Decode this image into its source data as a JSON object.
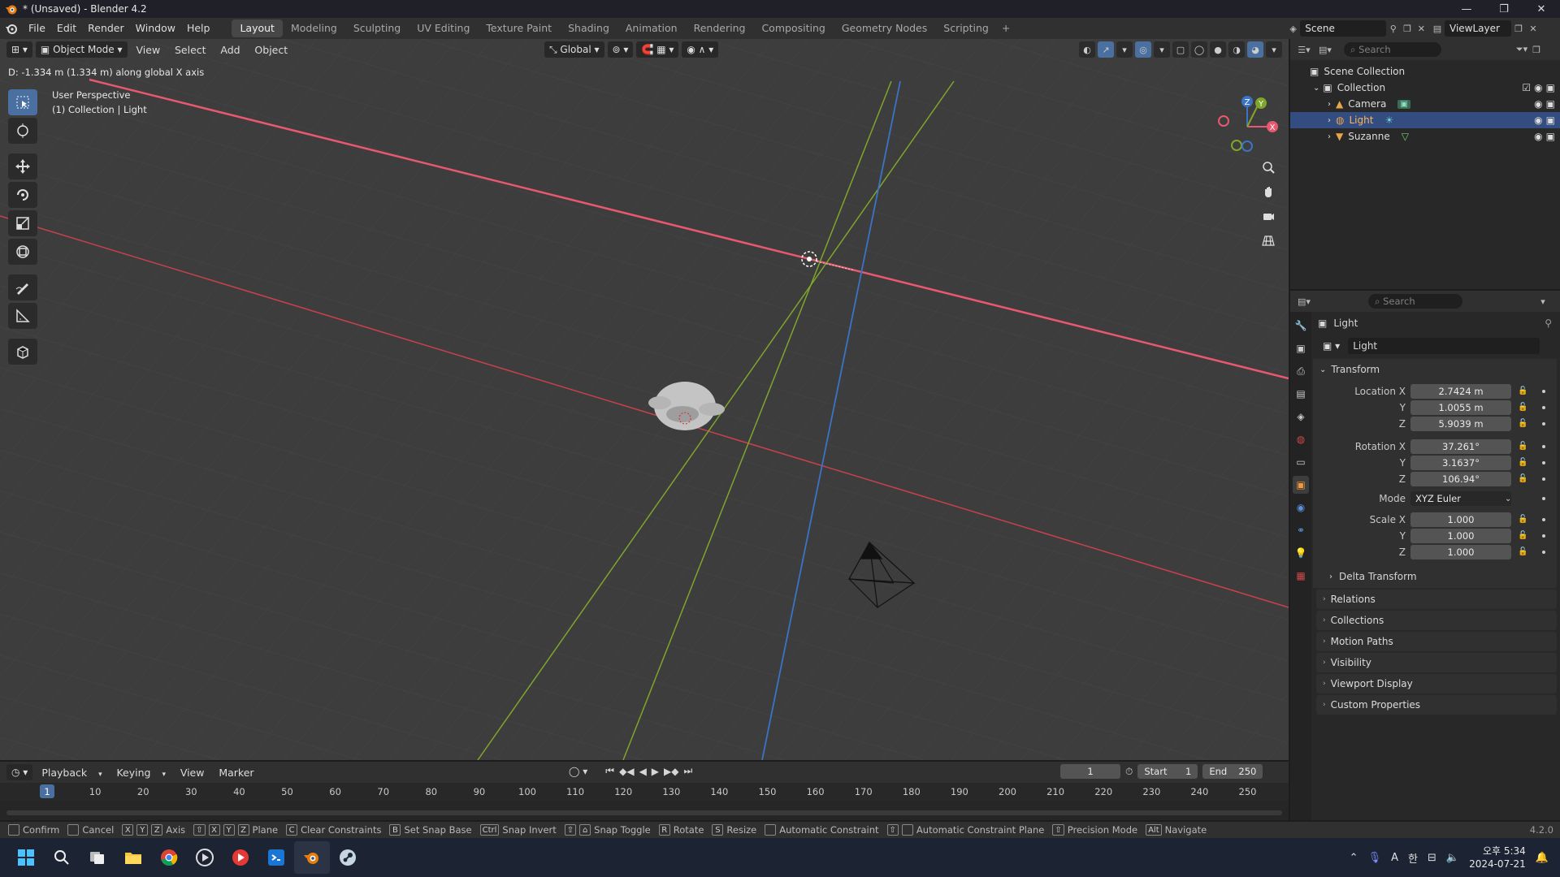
{
  "window": {
    "title": "* (Unsaved) - Blender 4.2"
  },
  "menus": [
    "File",
    "Edit",
    "Render",
    "Window",
    "Help"
  ],
  "workspaces": [
    {
      "label": "Layout",
      "active": true
    },
    {
      "label": "Modeling"
    },
    {
      "label": "Sculpting"
    },
    {
      "label": "UV Editing"
    },
    {
      "label": "Texture Paint"
    },
    {
      "label": "Shading"
    },
    {
      "label": "Animation"
    },
    {
      "label": "Rendering"
    },
    {
      "label": "Compositing"
    },
    {
      "label": "Geometry Nodes"
    },
    {
      "label": "Scripting"
    }
  ],
  "scene": {
    "name": "Scene",
    "view_layer": "ViewLayer"
  },
  "viewport": {
    "mode": "Object Mode",
    "menus": [
      "View",
      "Select",
      "Add",
      "Object"
    ],
    "orientation": "Global",
    "status_text": "D: -1.334 m (1.334 m) along global X axis",
    "perspective": "User Perspective",
    "context": "(1) Collection | Light",
    "gizmo_axes": [
      "X",
      "Y",
      "Z"
    ]
  },
  "outliner": {
    "search_placeholder": "Search",
    "root": "Scene Collection",
    "collection": "Collection",
    "items": [
      {
        "label": "Camera",
        "selected": false
      },
      {
        "label": "Light",
        "selected": true
      },
      {
        "label": "Suzanne",
        "selected": false
      }
    ]
  },
  "properties": {
    "search_placeholder": "Search",
    "object_name": "Light",
    "datablock": "Light",
    "transform_title": "Transform",
    "location": {
      "label_x": "Location X",
      "label_y": "Y",
      "label_z": "Z",
      "x": "2.7424 m",
      "y": "1.0055 m",
      "z": "5.9039 m"
    },
    "rotation": {
      "label_x": "Rotation X",
      "label_y": "Y",
      "label_z": "Z",
      "x": "37.261°",
      "y": "3.1637°",
      "z": "106.94°"
    },
    "mode": {
      "label": "Mode",
      "value": "XYZ Euler"
    },
    "scale": {
      "label_x": "Scale X",
      "label_y": "Y",
      "label_z": "Z",
      "x": "1.000",
      "y": "1.000",
      "z": "1.000"
    },
    "delta_transform": "Delta Transform",
    "panels": [
      "Relations",
      "Collections",
      "Motion Paths",
      "Visibility",
      "Viewport Display",
      "Custom Properties"
    ]
  },
  "timeline": {
    "menus": [
      "Playback",
      "Keying",
      "View",
      "Marker"
    ],
    "current_frame": "1",
    "start_label": "Start",
    "start": "1",
    "end_label": "End",
    "end": "250",
    "ruler": [
      "1",
      "10",
      "20",
      "30",
      "40",
      "50",
      "60",
      "70",
      "80",
      "90",
      "100",
      "110",
      "120",
      "130",
      "140",
      "150",
      "160",
      "170",
      "180",
      "190",
      "200",
      "210",
      "220",
      "230",
      "240",
      "250"
    ]
  },
  "statusbar": {
    "items": [
      {
        "keys": [
          ""
        ],
        "label": "Confirm"
      },
      {
        "keys": [
          ""
        ],
        "label": "Cancel"
      },
      {
        "keys": [
          "X",
          "Y",
          "Z"
        ],
        "label": "Axis"
      },
      {
        "keys": [
          "⇧",
          "X",
          "Y",
          "Z"
        ],
        "label": "Plane"
      },
      {
        "keys": [
          "C"
        ],
        "label": "Clear Constraints"
      },
      {
        "keys": [
          "B"
        ],
        "label": "Set Snap Base"
      },
      {
        "keys": [
          "Ctrl"
        ],
        "label": "Snap Invert"
      },
      {
        "keys": [
          "⇧",
          "⌂"
        ],
        "label": "Snap Toggle"
      },
      {
        "keys": [
          "R"
        ],
        "label": "Rotate"
      },
      {
        "keys": [
          "S"
        ],
        "label": "Resize"
      },
      {
        "keys": [
          ""
        ],
        "label": "Automatic Constraint"
      },
      {
        "keys": [
          "⇧",
          ""
        ],
        "label": "Automatic Constraint Plane"
      },
      {
        "keys": [
          "⇧"
        ],
        "label": "Precision Mode"
      },
      {
        "keys": [
          "Alt"
        ],
        "label": "Navigate"
      }
    ],
    "version": "4.2.0"
  },
  "taskbar": {
    "ime": "A",
    "ime2": "한",
    "time": "오후 5:34",
    "date": "2024-07-21"
  },
  "colors": {
    "x_axis": "#e8596f",
    "y_axis": "#7fa52b",
    "z_axis": "#3b73c5",
    "accent": "#4a6fa1",
    "selected_row": "#334d80"
  }
}
